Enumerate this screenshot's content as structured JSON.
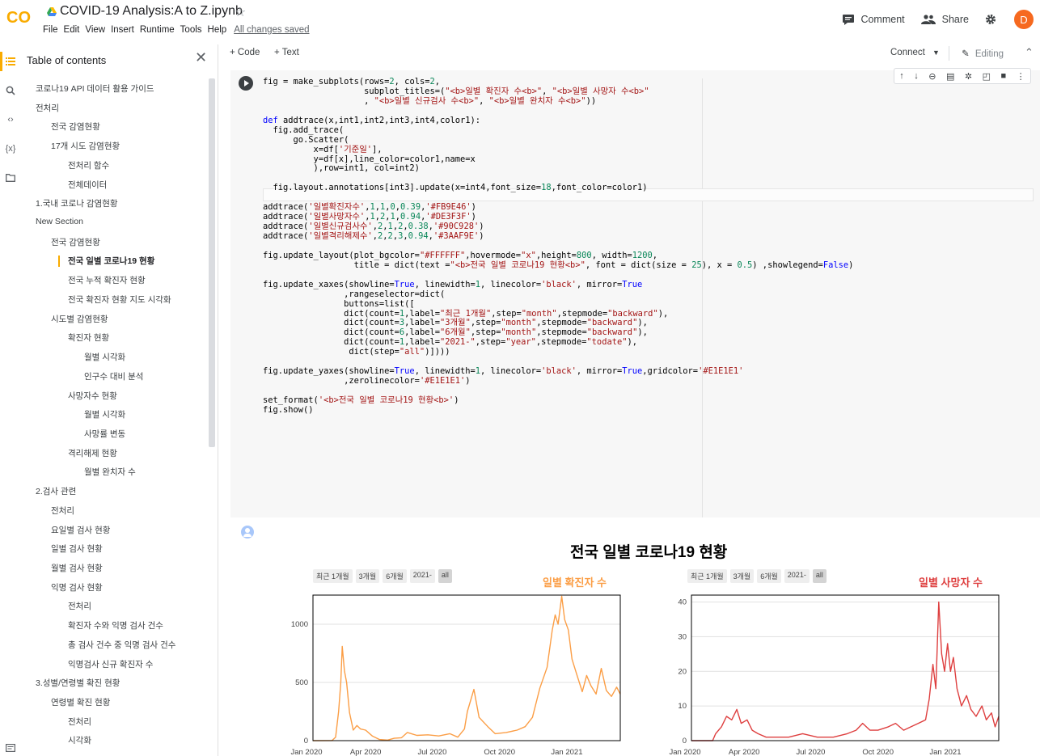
{
  "header": {
    "logo": "CO",
    "title": "COVID-19 Analysis:A to Z.ipynb",
    "menu": [
      "File",
      "Edit",
      "View",
      "Insert",
      "Runtime",
      "Tools",
      "Help"
    ],
    "save_status": "All changes saved",
    "comment_label": "Comment",
    "share_label": "Share",
    "avatar_letter": "D",
    "avatar_color": "#f6691f"
  },
  "toc": {
    "title": "Table of contents",
    "items": [
      {
        "label": "코로나19 API 데이터 활용 가이드",
        "level": 1
      },
      {
        "label": "전처리",
        "level": 1
      },
      {
        "label": "전국 감염현황",
        "level": 2
      },
      {
        "label": "17개 시도 감염현황",
        "level": 2
      },
      {
        "label": "전처리 함수",
        "level": 3
      },
      {
        "label": "전체데이터",
        "level": 3
      },
      {
        "label": "1.국내 코로나 감염현황",
        "level": 1
      },
      {
        "label": "New Section",
        "level": 1
      },
      {
        "label": "전국 감염현황",
        "level": 2
      },
      {
        "label": "전국 일별 코로나19 현황",
        "level": 3,
        "active": true
      },
      {
        "label": "전국 누적 확진자 현황",
        "level": 3
      },
      {
        "label": "전국 확진자 현황 지도 시각화",
        "level": 3
      },
      {
        "label": "시도별 감염현황",
        "level": 2
      },
      {
        "label": "확진자 현황",
        "level": 3
      },
      {
        "label": "월별 시각화",
        "level": 4
      },
      {
        "label": "인구수 대비 분석",
        "level": 4
      },
      {
        "label": "사망자수 현황",
        "level": 3
      },
      {
        "label": "월별 시각화",
        "level": 4
      },
      {
        "label": "사망률 변동",
        "level": 4
      },
      {
        "label": "격리해제 현황",
        "level": 3
      },
      {
        "label": "월별 완치자 수",
        "level": 4
      },
      {
        "label": "2.검사 관련",
        "level": 1
      },
      {
        "label": "전처리",
        "level": 2
      },
      {
        "label": "요일별 검사 현황",
        "level": 2
      },
      {
        "label": "일별 검사 현황",
        "level": 2
      },
      {
        "label": "월별 검사 현황",
        "level": 2
      },
      {
        "label": "익명 검사 현황",
        "level": 2
      },
      {
        "label": "전처리",
        "level": 3
      },
      {
        "label": "확진자 수와 익명 검사 건수",
        "level": 3
      },
      {
        "label": "총 검사 건수 중 익명 검사 건수",
        "level": 3
      },
      {
        "label": "익명검사 신규 확진자 수",
        "level": 3
      },
      {
        "label": "3.성별/연령별 확진 현황",
        "level": 1
      },
      {
        "label": "연령별 확진 현황",
        "level": 2
      },
      {
        "label": "전처리",
        "level": 3
      },
      {
        "label": "시각화",
        "level": 3
      }
    ]
  },
  "toolbar": {
    "add_code": "+ Code",
    "add_text": "+ Text",
    "connect": "Connect",
    "editing": "Editing"
  },
  "cell": {
    "code_lines": [
      "fig = make_subplots(rows=2, cols=2,",
      "                    subplot_titles=(\"<b>일별 확진자 수<b>\", \"<b>일별 사망자 수<b>\"",
      "                    , \"<b>일별 신규검사 수<b>\", \"<b>일별 완치자 수<b>\"))",
      "",
      "def addtrace(x,int1,int2,int3,int4,color1):",
      "  fig.add_trace(",
      "      go.Scatter(",
      "          x=df['기준일'],",
      "          y=df[x],line_color=color1,name=x",
      "          ),row=int1, col=int2)",
      "",
      "  fig.layout.annotations[int3].update(x=int4,font_size=18,font_color=color1)",
      "",
      "addtrace('일별확진자수',1,1,0,0.39,'#FB9E46')",
      "addtrace('일별사망자수',1,2,1,0.94,'#DE3F3F')",
      "addtrace('일별신규검사수',2,1,2,0.38,'#90C928')",
      "addtrace('일별격리해제수',2,2,3,0.94,'#3AAF9E')",
      "",
      "fig.update_layout(plot_bgcolor=\"#FFFFFF\",hovermode=\"x\",height=800, width=1200,",
      "                  title = dict(text =\"<b>전국 일별 코로나19 현황<b>\", font = dict(size = 25), x = 0.5) ,showlegend=False)",
      "",
      "fig.update_xaxes(showline=True, linewidth=1, linecolor='black', mirror=True",
      "                ,rangeselector=dict(",
      "                buttons=list([",
      "                dict(count=1,label=\"최근 1개월\",step=\"month\",stepmode=\"backward\"),",
      "                dict(count=3,label=\"3개월\",step=\"month\",stepmode=\"backward\"),",
      "                dict(count=6,label=\"6개월\",step=\"month\",stepmode=\"backward\"),",
      "                dict(count=1,label=\"2021-\",step=\"year\",stepmode=\"todate\"),",
      "                 dict(step=\"all\")])))",
      "",
      "fig.update_yaxes(showline=True, linewidth=1, linecolor='black', mirror=True,gridcolor='#E1E1E1'",
      "                ,zerolinecolor='#E1E1E1')",
      "",
      "set_format('<b>전국 일별 코로나19 현황<b>')",
      "fig.show()"
    ]
  },
  "output": {
    "plot_title": "전국 일별 코로나19 현황",
    "range_buttons": [
      "최근 1개월",
      "3개월",
      "6개월",
      "2021-",
      "all"
    ]
  },
  "chart_data": [
    {
      "type": "line",
      "title": "일별 확진자 수",
      "color": "#FB9E46",
      "x_ticks": [
        "Jan 2020",
        "Apr 2020",
        "Jul 2020",
        "Oct 2020",
        "Jan 2021"
      ],
      "y_ticks": [
        "0",
        "500",
        "1000"
      ],
      "ylim": [
        0,
        1250
      ],
      "xlim": [
        "2020-01-20",
        "2021-03-15"
      ],
      "grid": true,
      "points": [
        [
          "2020-01-20",
          0
        ],
        [
          "2020-02-15",
          1
        ],
        [
          "2020-02-20",
          30
        ],
        [
          "2020-02-24",
          250
        ],
        [
          "2020-02-27",
          500
        ],
        [
          "2020-02-29",
          810
        ],
        [
          "2020-03-03",
          600
        ],
        [
          "2020-03-06",
          500
        ],
        [
          "2020-03-10",
          240
        ],
        [
          "2020-03-15",
          90
        ],
        [
          "2020-03-20",
          130
        ],
        [
          "2020-03-25",
          100
        ],
        [
          "2020-04-01",
          90
        ],
        [
          "2020-04-10",
          40
        ],
        [
          "2020-04-20",
          10
        ],
        [
          "2020-05-01",
          5
        ],
        [
          "2020-05-10",
          20
        ],
        [
          "2020-05-20",
          25
        ],
        [
          "2020-05-28",
          70
        ],
        [
          "2020-06-10",
          45
        ],
        [
          "2020-06-25",
          50
        ],
        [
          "2020-07-10",
          40
        ],
        [
          "2020-07-25",
          60
        ],
        [
          "2020-08-05",
          30
        ],
        [
          "2020-08-14",
          100
        ],
        [
          "2020-08-18",
          250
        ],
        [
          "2020-08-27",
          440
        ],
        [
          "2020-09-03",
          200
        ],
        [
          "2020-09-15",
          120
        ],
        [
          "2020-09-25",
          60
        ],
        [
          "2020-10-10",
          70
        ],
        [
          "2020-10-25",
          90
        ],
        [
          "2020-11-05",
          120
        ],
        [
          "2020-11-15",
          200
        ],
        [
          "2020-11-25",
          450
        ],
        [
          "2020-12-05",
          630
        ],
        [
          "2020-12-12",
          950
        ],
        [
          "2020-12-16",
          1080
        ],
        [
          "2020-12-20",
          1000
        ],
        [
          "2020-12-25",
          1240
        ],
        [
          "2020-12-29",
          1040
        ],
        [
          "2021-01-03",
          950
        ],
        [
          "2021-01-08",
          700
        ],
        [
          "2021-01-15",
          560
        ],
        [
          "2021-01-22",
          420
        ],
        [
          "2021-01-28",
          560
        ],
        [
          "2021-02-03",
          470
        ],
        [
          "2021-02-10",
          400
        ],
        [
          "2021-02-17",
          620
        ],
        [
          "2021-02-24",
          430
        ],
        [
          "2021-03-03",
          380
        ],
        [
          "2021-03-10",
          460
        ],
        [
          "2021-03-15",
          400
        ]
      ]
    },
    {
      "type": "line",
      "title": "일별 사망자 수",
      "color": "#DE3F3F",
      "x_ticks": [
        "Jan 2020",
        "Apr 2020",
        "Jul 2020",
        "Oct 2020",
        "Jan 2021"
      ],
      "y_ticks": [
        "0",
        "10",
        "20",
        "30",
        "40"
      ],
      "ylim": [
        0,
        42
      ],
      "xlim": [
        "2020-01-20",
        "2021-03-15"
      ],
      "grid": true,
      "points": [
        [
          "2020-01-20",
          0
        ],
        [
          "2020-02-18",
          0
        ],
        [
          "2020-02-22",
          2
        ],
        [
          "2020-03-01",
          4
        ],
        [
          "2020-03-08",
          7
        ],
        [
          "2020-03-15",
          6
        ],
        [
          "2020-03-22",
          9
        ],
        [
          "2020-03-28",
          5
        ],
        [
          "2020-04-05",
          6
        ],
        [
          "2020-04-12",
          3
        ],
        [
          "2020-04-20",
          2
        ],
        [
          "2020-05-01",
          1
        ],
        [
          "2020-05-15",
          1
        ],
        [
          "2020-06-01",
          1
        ],
        [
          "2020-06-20",
          2
        ],
        [
          "2020-07-10",
          1
        ],
        [
          "2020-08-01",
          1
        ],
        [
          "2020-08-20",
          2
        ],
        [
          "2020-09-01",
          3
        ],
        [
          "2020-09-10",
          5
        ],
        [
          "2020-09-20",
          3
        ],
        [
          "2020-10-01",
          3
        ],
        [
          "2020-10-15",
          4
        ],
        [
          "2020-10-25",
          5
        ],
        [
          "2020-11-05",
          3
        ],
        [
          "2020-11-15",
          4
        ],
        [
          "2020-11-25",
          5
        ],
        [
          "2020-12-05",
          6
        ],
        [
          "2020-12-10",
          12
        ],
        [
          "2020-12-15",
          22
        ],
        [
          "2020-12-19",
          15
        ],
        [
          "2020-12-23",
          40
        ],
        [
          "2020-12-27",
          25
        ],
        [
          "2020-12-31",
          20
        ],
        [
          "2021-01-04",
          28
        ],
        [
          "2021-01-08",
          20
        ],
        [
          "2021-01-12",
          24
        ],
        [
          "2021-01-17",
          15
        ],
        [
          "2021-01-23",
          10
        ],
        [
          "2021-01-30",
          13
        ],
        [
          "2021-02-05",
          9
        ],
        [
          "2021-02-12",
          7
        ],
        [
          "2021-02-20",
          10
        ],
        [
          "2021-02-26",
          6
        ],
        [
          "2021-03-05",
          8
        ],
        [
          "2021-03-10",
          4
        ],
        [
          "2021-03-15",
          7
        ]
      ]
    }
  ]
}
